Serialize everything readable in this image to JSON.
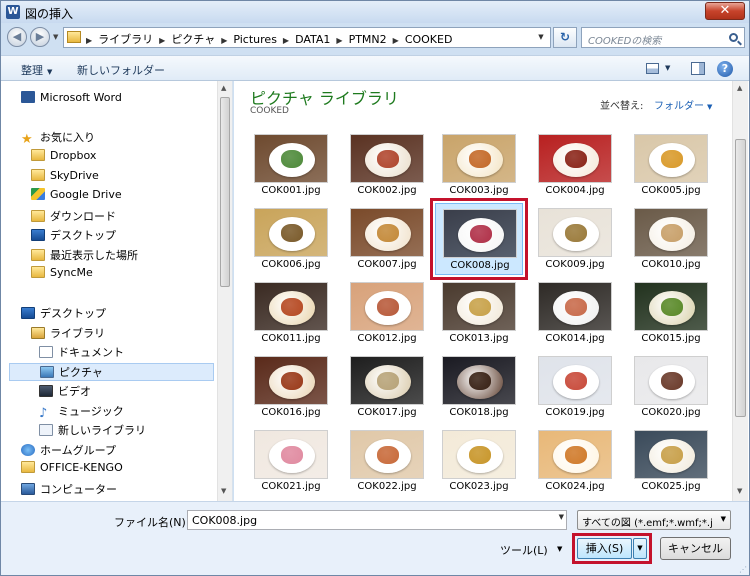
{
  "window": {
    "title": "図の挿入",
    "app_icon": "W",
    "close": "✕"
  },
  "address": {
    "crumbs": [
      "ライブラリ",
      "ピクチャ",
      "Pictures",
      "DATA1",
      "PTMN2",
      "COOKED"
    ],
    "search_placeholder": "COOKEDの検索"
  },
  "toolbar": {
    "organize": "整理",
    "new_folder": "新しいフォルダー"
  },
  "nav": {
    "items": [
      {
        "label": "Microsoft Word",
        "icon": "word-icon",
        "cls": "ico-word"
      },
      {
        "label": "お気に入り",
        "icon": "star-icon",
        "cls": "ico-star",
        "glyph": "★"
      },
      {
        "label": "Dropbox",
        "icon": "folder-icon",
        "cls": "ico-folder"
      },
      {
        "label": "SkyDrive",
        "icon": "folder-icon",
        "cls": "ico-folder"
      },
      {
        "label": "Google Drive",
        "icon": "google-drive-icon",
        "cls": "ico-gdrive"
      },
      {
        "label": "ダウンロード",
        "icon": "download-icon",
        "cls": "ico-download"
      },
      {
        "label": "デスクトップ",
        "icon": "desktop-icon",
        "cls": "ico-desktop"
      },
      {
        "label": "最近表示した場所",
        "icon": "recent-places-icon",
        "cls": "ico-recent"
      },
      {
        "label": "SyncMe",
        "icon": "folder-icon",
        "cls": "ico-folder"
      },
      {
        "label": "デスクトップ",
        "icon": "desktop-icon",
        "cls": "ico-desktop"
      },
      {
        "label": "ライブラリ",
        "icon": "library-icon",
        "cls": "ico-library"
      },
      {
        "label": "ドキュメント",
        "icon": "document-icon",
        "cls": "ico-doc"
      },
      {
        "label": "ピクチャ",
        "icon": "picture-icon",
        "cls": "ico-pic",
        "selected": true
      },
      {
        "label": "ビデオ",
        "icon": "video-icon",
        "cls": "ico-video"
      },
      {
        "label": "ミュージック",
        "icon": "music-icon",
        "cls": "ico-music",
        "glyph": "♪"
      },
      {
        "label": "新しいライブラリ",
        "icon": "new-library-icon",
        "cls": "ico-newlib"
      },
      {
        "label": "ホームグループ",
        "icon": "homegroup-icon",
        "cls": "ico-homegroup"
      },
      {
        "label": "OFFICE-KENGO",
        "icon": "folder-icon",
        "cls": "ico-folder"
      },
      {
        "label": "コンピューター",
        "icon": "computer-icon",
        "cls": "ico-pc"
      }
    ]
  },
  "content": {
    "title": "ピクチャ ライブラリ",
    "subtitle": "COOKED",
    "arrange_label": "並べ替え:",
    "arrange_value": "フォルダー",
    "files": [
      {
        "name": "COK001.jpg",
        "bg": "#6e4a2f",
        "plate": "#fff",
        "food": "#4e8a3a"
      },
      {
        "name": "COK002.jpg",
        "bg": "#5a3222",
        "plate": "#e9dcc8",
        "food": "#b0462e"
      },
      {
        "name": "COK003.jpg",
        "bg": "#c9a46a",
        "plate": "#f3e3c1",
        "food": "#c46a2a"
      },
      {
        "name": "COK004.jpg",
        "bg": "#b82020",
        "plate": "#f5e6d6",
        "food": "#8a2418"
      },
      {
        "name": "COK005.jpg",
        "bg": "#d9c7a8",
        "plate": "#fff",
        "food": "#d99a2a"
      },
      {
        "name": "COK006.jpg",
        "bg": "#c9a45a",
        "plate": "#fff",
        "food": "#7a5a2a"
      },
      {
        "name": "COK007.jpg",
        "bg": "#7a4a2a",
        "plate": "#f0e0c8",
        "food": "#c48a3a"
      },
      {
        "name": "COK008.jpg",
        "bg": "#3a3e4a",
        "plate": "#f4f4f4",
        "food": "#b03048",
        "selected": true
      },
      {
        "name": "COK009.jpg",
        "bg": "#e8e2d8",
        "plate": "#fff",
        "food": "#9a7a3a"
      },
      {
        "name": "COK010.jpg",
        "bg": "#6a5a48",
        "plate": "#f3ece0",
        "food": "#c8a06a"
      },
      {
        "name": "COK011.jpg",
        "bg": "#3a2a22",
        "plate": "#e8d2a8",
        "food": "#b64a24"
      },
      {
        "name": "COK012.jpg",
        "bg": "#d8a27a",
        "plate": "#fff",
        "food": "#b85a3a"
      },
      {
        "name": "COK013.jpg",
        "bg": "#4a3a2e",
        "plate": "#f0e6d4",
        "food": "#c8a24a"
      },
      {
        "name": "COK014.jpg",
        "bg": "#2e2a26",
        "plate": "#eee",
        "food": "#c86a4a"
      },
      {
        "name": "COK015.jpg",
        "bg": "#22321e",
        "plate": "#d8d0a8",
        "food": "#5a8a2a"
      },
      {
        "name": "COK016.jpg",
        "bg": "#5a2a1a",
        "plate": "#e8d2b0",
        "food": "#9a3a1a"
      },
      {
        "name": "COK017.jpg",
        "bg": "#1e1e1e",
        "plate": "#d8c8a8",
        "food": "#b8a47a"
      },
      {
        "name": "COK018.jpg",
        "bg": "#1a1a22",
        "plate": "#5a3a2a",
        "food": "#3a2418"
      },
      {
        "name": "COK019.jpg",
        "bg": "#dfe3ea",
        "plate": "#fff",
        "food": "#c84a3a"
      },
      {
        "name": "COK020.jpg",
        "bg": "#e8e8ea",
        "plate": "#fff",
        "food": "#6a3a2a"
      },
      {
        "name": "COK021.jpg",
        "bg": "#f0e8e0",
        "plate": "#fff",
        "food": "#e08aa0"
      },
      {
        "name": "COK022.jpg",
        "bg": "#e0c8a8",
        "plate": "#fff",
        "food": "#c86a3a"
      },
      {
        "name": "COK023.jpg",
        "bg": "#f3ead8",
        "plate": "#fff",
        "food": "#c8962a"
      },
      {
        "name": "COK024.jpg",
        "bg": "#e8b878",
        "plate": "#fff4e0",
        "food": "#d07a2a"
      },
      {
        "name": "COK025.jpg",
        "bg": "#3a4a5a",
        "plate": "#f0e8d8",
        "food": "#c8a04a"
      }
    ]
  },
  "footer": {
    "filename_label": "ファイル名(N):",
    "filename_value": "COK008.jpg",
    "filter_value": "すべての図 (*.emf;*.wmf;*.j",
    "tools_label": "ツール(L)",
    "insert_label": "挿入(S)",
    "cancel_label": "キャンセル"
  }
}
